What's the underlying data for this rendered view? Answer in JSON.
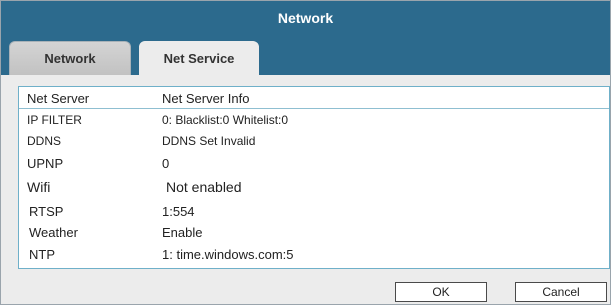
{
  "window": {
    "title": "Network"
  },
  "tabs": [
    {
      "label": "Network",
      "active": false
    },
    {
      "label": "Net Service",
      "active": true
    }
  ],
  "table": {
    "columns": [
      "Net Server",
      "Net Server Info"
    ],
    "rows": [
      {
        "server": "IP FILTER",
        "info": "0: Blacklist:0 Whitelist:0"
      },
      {
        "server": "DDNS",
        "info": "DDNS Set Invalid"
      },
      {
        "server": "UPNP",
        "info": "0"
      },
      {
        "server": "Wifi",
        "info": "Not enabled"
      },
      {
        "server": "RTSP",
        "info": "1:554"
      },
      {
        "server": "Weather",
        "info": "Enable"
      },
      {
        "server": "NTP",
        "info": "1: time.windows.com:5"
      }
    ]
  },
  "buttons": {
    "ok": "OK",
    "cancel": "Cancel"
  },
  "colors": {
    "titlebar": "#2c6a8d",
    "panel_border": "#6fb0c9"
  }
}
